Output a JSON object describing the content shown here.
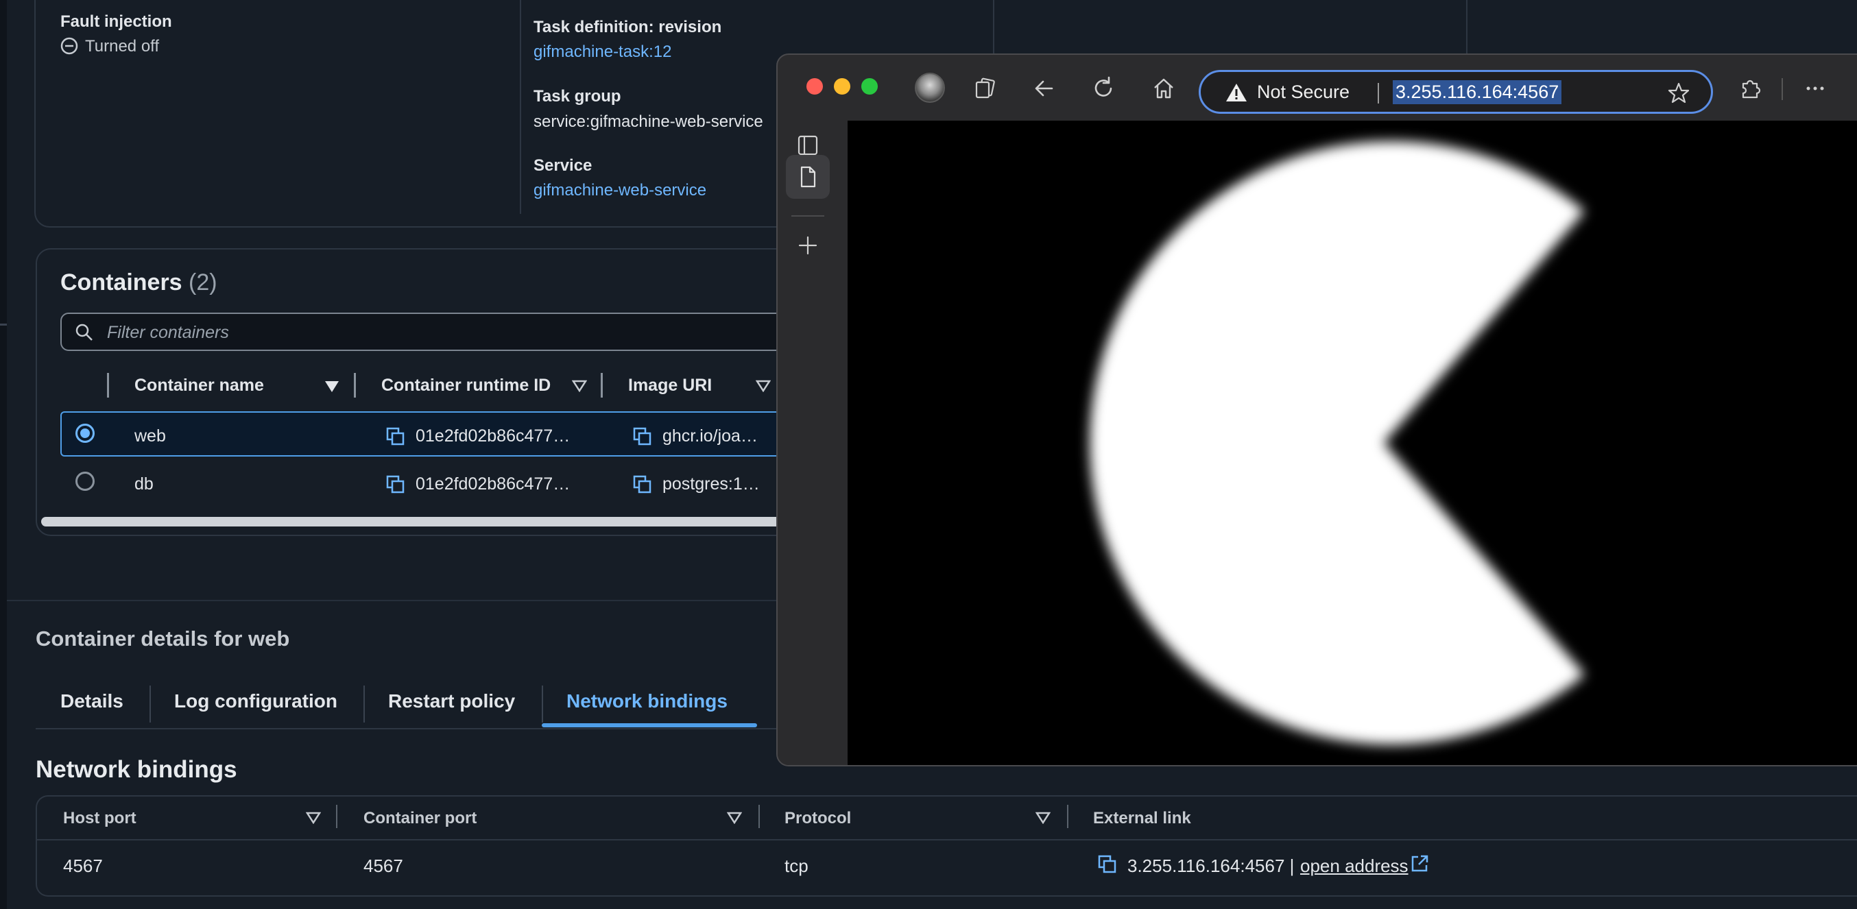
{
  "task_info": {
    "fault_injection_label": "Fault injection",
    "fault_injection_value": "Turned off",
    "task_definition_label": "Task definition: revision",
    "task_definition_value": "gifmachine-task:12",
    "task_group_label": "Task group",
    "task_group_value": "service:gifmachine-web-service",
    "service_label": "Service",
    "service_value": "gifmachine-web-service"
  },
  "containers": {
    "title": "Containers",
    "count": "(2)",
    "filter_placeholder": "Filter containers",
    "columns": [
      "Container name",
      "Container runtime ID",
      "Image URI"
    ],
    "rows": [
      {
        "name": "web",
        "runtime_id": "01e2fd02b86c477…",
        "image_uri": "ghcr.io/joa…",
        "selected": true
      },
      {
        "name": "db",
        "runtime_id": "01e2fd02b86c477…",
        "image_uri": "postgres:1…",
        "selected": false
      }
    ]
  },
  "container_details": {
    "title": "Container details for web",
    "tabs": [
      "Details",
      "Log configuration",
      "Restart policy",
      "Network bindings"
    ],
    "active_tab": "Network bindings"
  },
  "network_bindings": {
    "title": "Network bindings",
    "columns": [
      "Host port",
      "Container port",
      "Protocol",
      "External link"
    ],
    "rows": [
      {
        "host_port": "4567",
        "container_port": "4567",
        "protocol": "tcp",
        "external_link": "3.255.116.164:4567 |",
        "open_address": "open address"
      }
    ]
  },
  "browser": {
    "security_label": "Not Secure",
    "url": "3.255.116.164:4567",
    "icons": [
      "profile-avatar",
      "collections-icon",
      "back-icon",
      "reload-icon",
      "home-icon",
      "favorite-star-icon",
      "extensions-icon",
      "more-icon"
    ],
    "side_rail_icons": [
      "tab-actions-icon",
      "page-icon",
      "new-tab-icon"
    ],
    "content": "white pac-man shape on black background"
  },
  "colors": {
    "background": "#161d26",
    "link": "#6fb7ff",
    "accent": "#4f9ee8",
    "address_bar_border": "#5b8ee6"
  }
}
